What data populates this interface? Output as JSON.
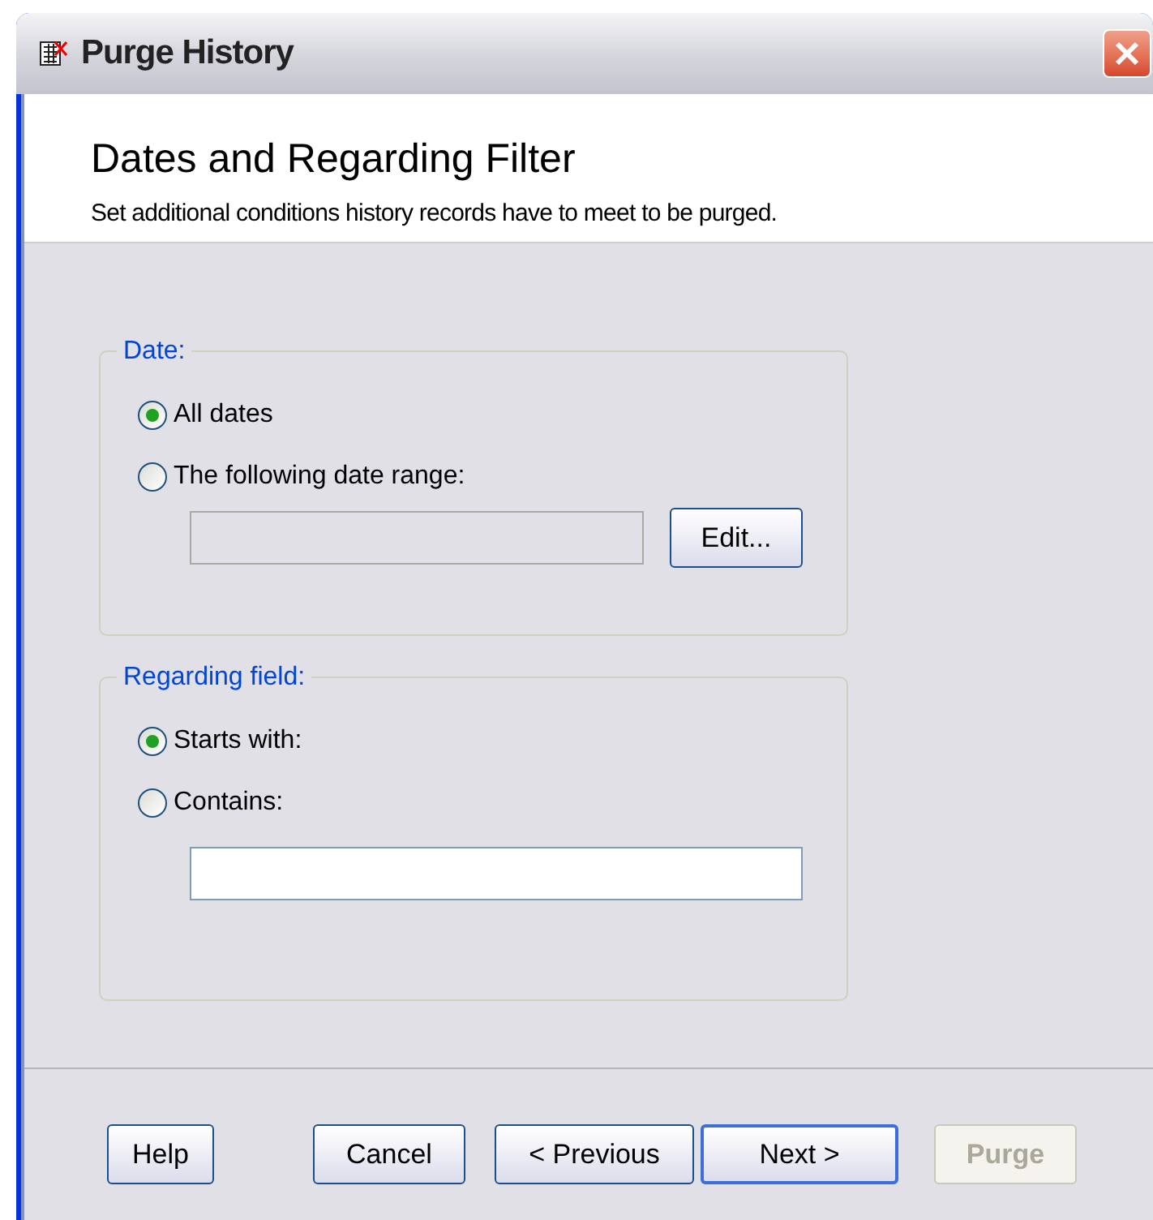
{
  "window": {
    "title": "Purge History"
  },
  "header": {
    "title": "Dates and Regarding Filter",
    "subtitle": "Set additional conditions history records have to meet to be purged."
  },
  "groups": [
    {
      "legend": "Date:",
      "options": [
        {
          "label": "All dates",
          "selected": true
        },
        {
          "label": "The following date range:",
          "selected": false
        }
      ],
      "field": {
        "disabled": true
      },
      "button": {
        "label": "Edit..."
      }
    },
    {
      "legend": "Regarding field:",
      "options": [
        {
          "label": "Starts with:",
          "selected": true
        },
        {
          "label": "Contains:",
          "selected": false
        }
      ],
      "field": {
        "disabled": false
      }
    }
  ],
  "buttons": [
    {
      "label": "Help",
      "disabled": false,
      "default": false
    },
    {
      "label": "Cancel",
      "disabled": false,
      "default": false
    },
    {
      "label": "< Previous",
      "disabled": false,
      "default": false
    },
    {
      "label": "Next >",
      "disabled": false,
      "default": true
    },
    {
      "label": "Purge",
      "disabled": true,
      "default": false
    }
  ]
}
